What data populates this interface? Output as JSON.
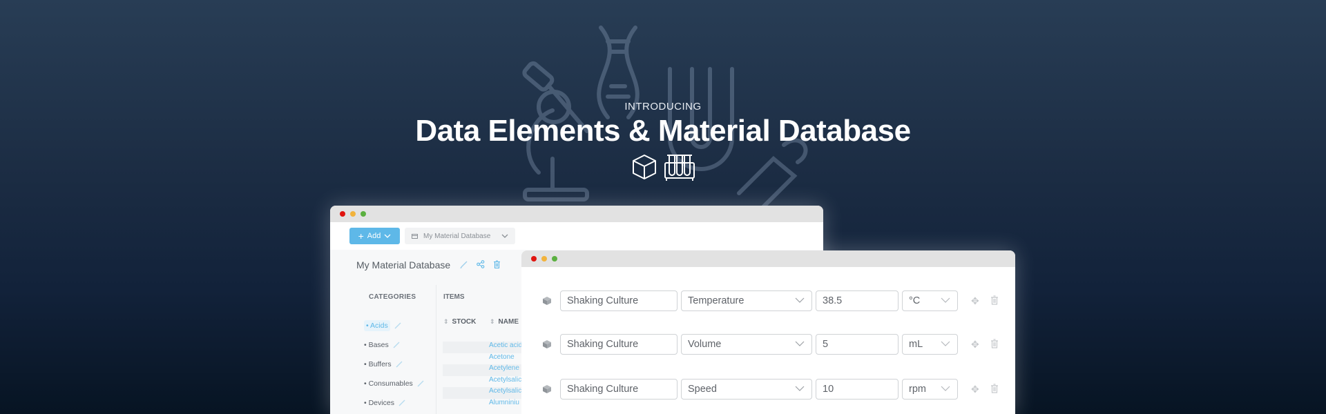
{
  "hero": {
    "eyebrow": "INTRODUCING",
    "title": "Data Elements & Material Database",
    "icons": [
      "cube-icon",
      "test-tubes-rack-icon"
    ]
  },
  "colors": {
    "accent": "#5eb8e8",
    "dot_close": "#e0140f",
    "dot_minimize": "#f2b33c",
    "dot_maximize": "#5bb040"
  },
  "material_window": {
    "add_button": "Add",
    "database_select": "My Material Database",
    "database_title": "My Material Database",
    "categories_heading": "CATEGORIES",
    "items_heading": "ITEMS",
    "categories": [
      {
        "label": "Acids",
        "active": true
      },
      {
        "label": "Bases",
        "active": false
      },
      {
        "label": "Buffers",
        "active": false
      },
      {
        "label": "Consumables",
        "active": false
      },
      {
        "label": "Devices",
        "active": false
      }
    ],
    "columns": [
      "STOCK",
      "NAME"
    ],
    "items": [
      "Acetic acid",
      "Acetone",
      "Acetylene",
      "Acetylsalic",
      "Acetylsalic",
      "Alumniniu"
    ]
  },
  "data_elements_window": {
    "rows": [
      {
        "name": "Shaking Culture",
        "type": "Temperature",
        "value": "38.5",
        "unit": "°C"
      },
      {
        "name": "Shaking Culture",
        "type": "Volume",
        "value": "5",
        "unit": "mL"
      },
      {
        "name": "Shaking Culture",
        "type": "Speed",
        "value": "10",
        "unit": "rpm"
      }
    ]
  }
}
